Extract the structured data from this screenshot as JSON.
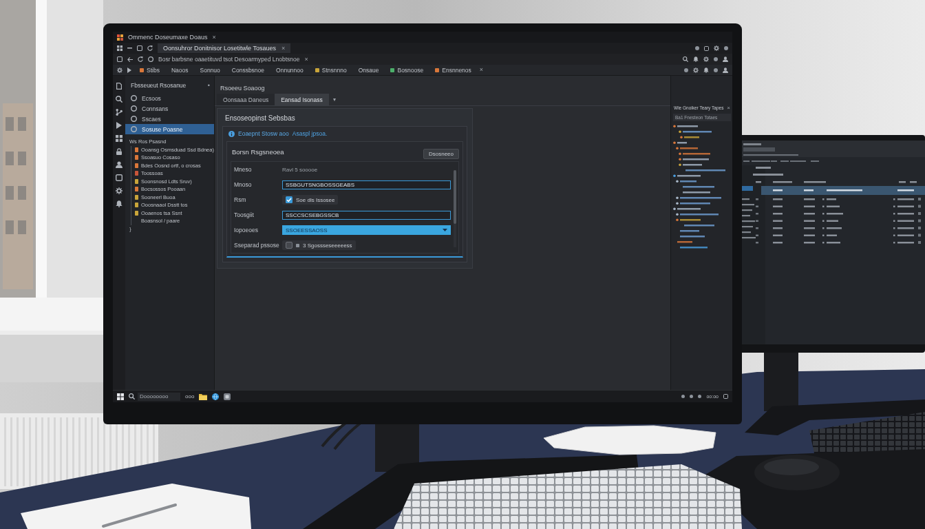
{
  "window": {
    "title": "Ommenc Doseumaxe Doaus",
    "close_glyph": "×"
  },
  "tab_bar": {
    "tabs": [
      {
        "label": "Oonsuhror Donitnisor Losetitwle Tosaues",
        "selected": true,
        "close_glyph": "×"
      }
    ]
  },
  "address_bar": {
    "text": "Bosr barbsne oaaetituvd tsot Desoarmyped Lnobtsnoe",
    "close_glyph": "×"
  },
  "menu": {
    "items": [
      {
        "label": "Stibs",
        "color": "#d9773a"
      },
      {
        "label": "Naoos"
      },
      {
        "label": "Sonnuo"
      },
      {
        "label": "Conssbsnoe"
      },
      {
        "label": "Onnunnoo"
      },
      {
        "label": "Stnsnnno",
        "color": "#c9a53a"
      },
      {
        "label": "Onsaue"
      },
      {
        "label": "Bosnoose",
        "color": "#4caf6a"
      },
      {
        "label": "Ensnnenos",
        "color": "#d9773a"
      }
    ],
    "more_glyph": "×"
  },
  "sidebar": {
    "title": "Fbsseueut Rsosanue",
    "close_glyph": "•",
    "items": [
      {
        "label": "Ecsoos",
        "selected": false
      },
      {
        "label": "Connsans",
        "selected": false
      },
      {
        "label": "Sscaes",
        "selected": false
      },
      {
        "label": "Sosuse Poasne",
        "selected": true
      }
    ],
    "tree": [
      {
        "label": "Ws Ros Psasnd",
        "children": [
          {
            "label": "Ooansg Osmsduad Ssd Bdnea)",
            "color": "#d9773a"
          },
          {
            "label": "Ssoasuo Cosaso",
            "color": "#d9773a"
          },
          {
            "label": "Bdes Oosnd ortf, o crosas",
            "color": "#d9773a"
          },
          {
            "label": "Toossoas",
            "color": "#c8553a"
          },
          {
            "label": "Soonsnosd Ldts Sruv)",
            "color": "#c9a53a"
          },
          {
            "label": "Bocsossos Pooaan",
            "color": "#d9773a"
          },
          {
            "label": "Sooneerl Buoa",
            "color": "#c9a53a"
          },
          {
            "label": "Ooosnaaol Dsstt tos",
            "color": "#c9a53a"
          },
          {
            "label": "Ooaenos tsa Ssnt",
            "color": "#c9a53a"
          },
          {
            "label": "Boasnsol / paare"
          }
        ]
      }
    ],
    "tree_end": "}"
  },
  "editor": {
    "title": "Rsoeeu Soaoog",
    "tabs": [
      {
        "label": "Oonsaaa Daneus",
        "selected": false
      },
      {
        "label": "Eansad Isonass",
        "selected": true
      }
    ],
    "tab_menu_glyph": "▾"
  },
  "settings": {
    "title": "Ensoseopinst Sebsbas",
    "notice": {
      "text": "Eoaepnt Stosw aoo",
      "link": "Asaspl jpsoa."
    },
    "group": {
      "title": "Borsn Rsgsneoea",
      "button": "Dsosneeo",
      "rows": [
        {
          "kind": "text",
          "label": "Mneso",
          "value": "Ravl 5 sooooe"
        },
        {
          "kind": "field",
          "label": "Mnoso",
          "value": "SSBGUTSNGBOSSGEABS"
        },
        {
          "kind": "checkbox",
          "label": "Rsm",
          "checked": true,
          "value": "Soe dls Issosee"
        },
        {
          "kind": "field",
          "label": "Toosgiit",
          "value": "SSCCSCSEBGSSCB"
        },
        {
          "kind": "select",
          "label": "Iopoeoes",
          "value": "SSOEESSAOSS"
        },
        {
          "kind": "checkbox",
          "label": "Sseparad pssose",
          "checked": false,
          "bullet": true,
          "value": "3 Sgossseseeeeess"
        }
      ]
    }
  },
  "outline": {
    "title": "Wie Gnoiker Teary Tapes",
    "close_glyph": "×",
    "filter": {
      "placeholder": "Ba1 Fnesteon Totaes"
    }
  },
  "taskbar": {
    "search": {
      "placeholder": "Doooooooo"
    },
    "label": "ooo",
    "clock": "oo:oo"
  }
}
